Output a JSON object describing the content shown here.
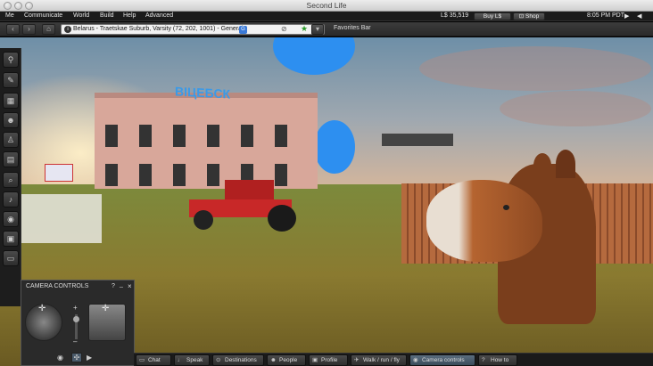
{
  "window": {
    "title": "Second Life"
  },
  "menu": {
    "items": [
      "Me",
      "Communicate",
      "World",
      "Build",
      "Help",
      "Advanced"
    ],
    "balance": "L$ 35,519",
    "buy_label": "Buy L$",
    "shop_label": "Shop",
    "clock": "8:05 PM PDT"
  },
  "nav": {
    "location": "Belarus - Traetskae Suburb, Varsity (72, 202, 1001) - General",
    "favorites_label": "Favorites Bar"
  },
  "scene": {
    "building_sign": "ВІЦЕБСК"
  },
  "sidebar": {
    "icons": [
      "link-icon",
      "pin-icon",
      "map-icon",
      "people-icon",
      "shirt-icon",
      "inventory-icon",
      "search-icon",
      "voice-icon",
      "radio-icon",
      "snapshot-icon",
      "chat-icon"
    ]
  },
  "camera_controls": {
    "title": "CAMERA CONTROLS",
    "help": "?",
    "minimize": "_",
    "close": "×",
    "zoom_in": "+",
    "zoom_out": "–"
  },
  "bottom_bar": {
    "buttons": [
      {
        "label": "Chat",
        "icon": "chat-bubble-icon"
      },
      {
        "label": "Speak",
        "icon": "microphone-icon"
      },
      {
        "label": "Destinations",
        "icon": "location-pin-icon"
      },
      {
        "label": "People",
        "icon": "people-icon"
      },
      {
        "label": "Profile",
        "icon": "profile-icon"
      },
      {
        "label": "Walk / run / fly",
        "icon": "walk-icon"
      },
      {
        "label": "Camera controls",
        "icon": "eye-icon"
      },
      {
        "label": "How to",
        "icon": "help-icon"
      }
    ]
  }
}
